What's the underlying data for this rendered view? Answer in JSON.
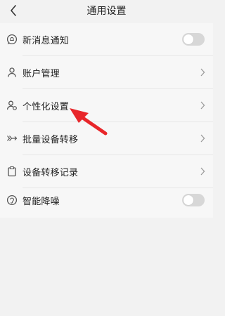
{
  "header": {
    "title": "通用设置"
  },
  "settings": {
    "items": [
      {
        "label": "新消息通知",
        "control": "toggle",
        "icon": "chat-bell-icon"
      },
      {
        "label": "账户管理",
        "control": "chevron",
        "icon": "user-icon"
      },
      {
        "label": "个性化设置",
        "control": "chevron",
        "icon": "user-settings-icon"
      },
      {
        "label": "批量设备转移",
        "control": "chevron",
        "icon": "transfer-icon"
      },
      {
        "label": "设备转移记录",
        "control": "chevron",
        "icon": "clipboard-icon"
      },
      {
        "label": "智能降噪",
        "control": "toggle",
        "icon": "noise-reduction-icon"
      }
    ],
    "toggles": {
      "new_message_notification": false,
      "smart_noise_reduction": false
    }
  },
  "colors": {
    "background": "#f2f2f2",
    "card": "#f7f7f7",
    "annotation_arrow": "#e8262a",
    "toggle_off": "#d7d7d7"
  }
}
